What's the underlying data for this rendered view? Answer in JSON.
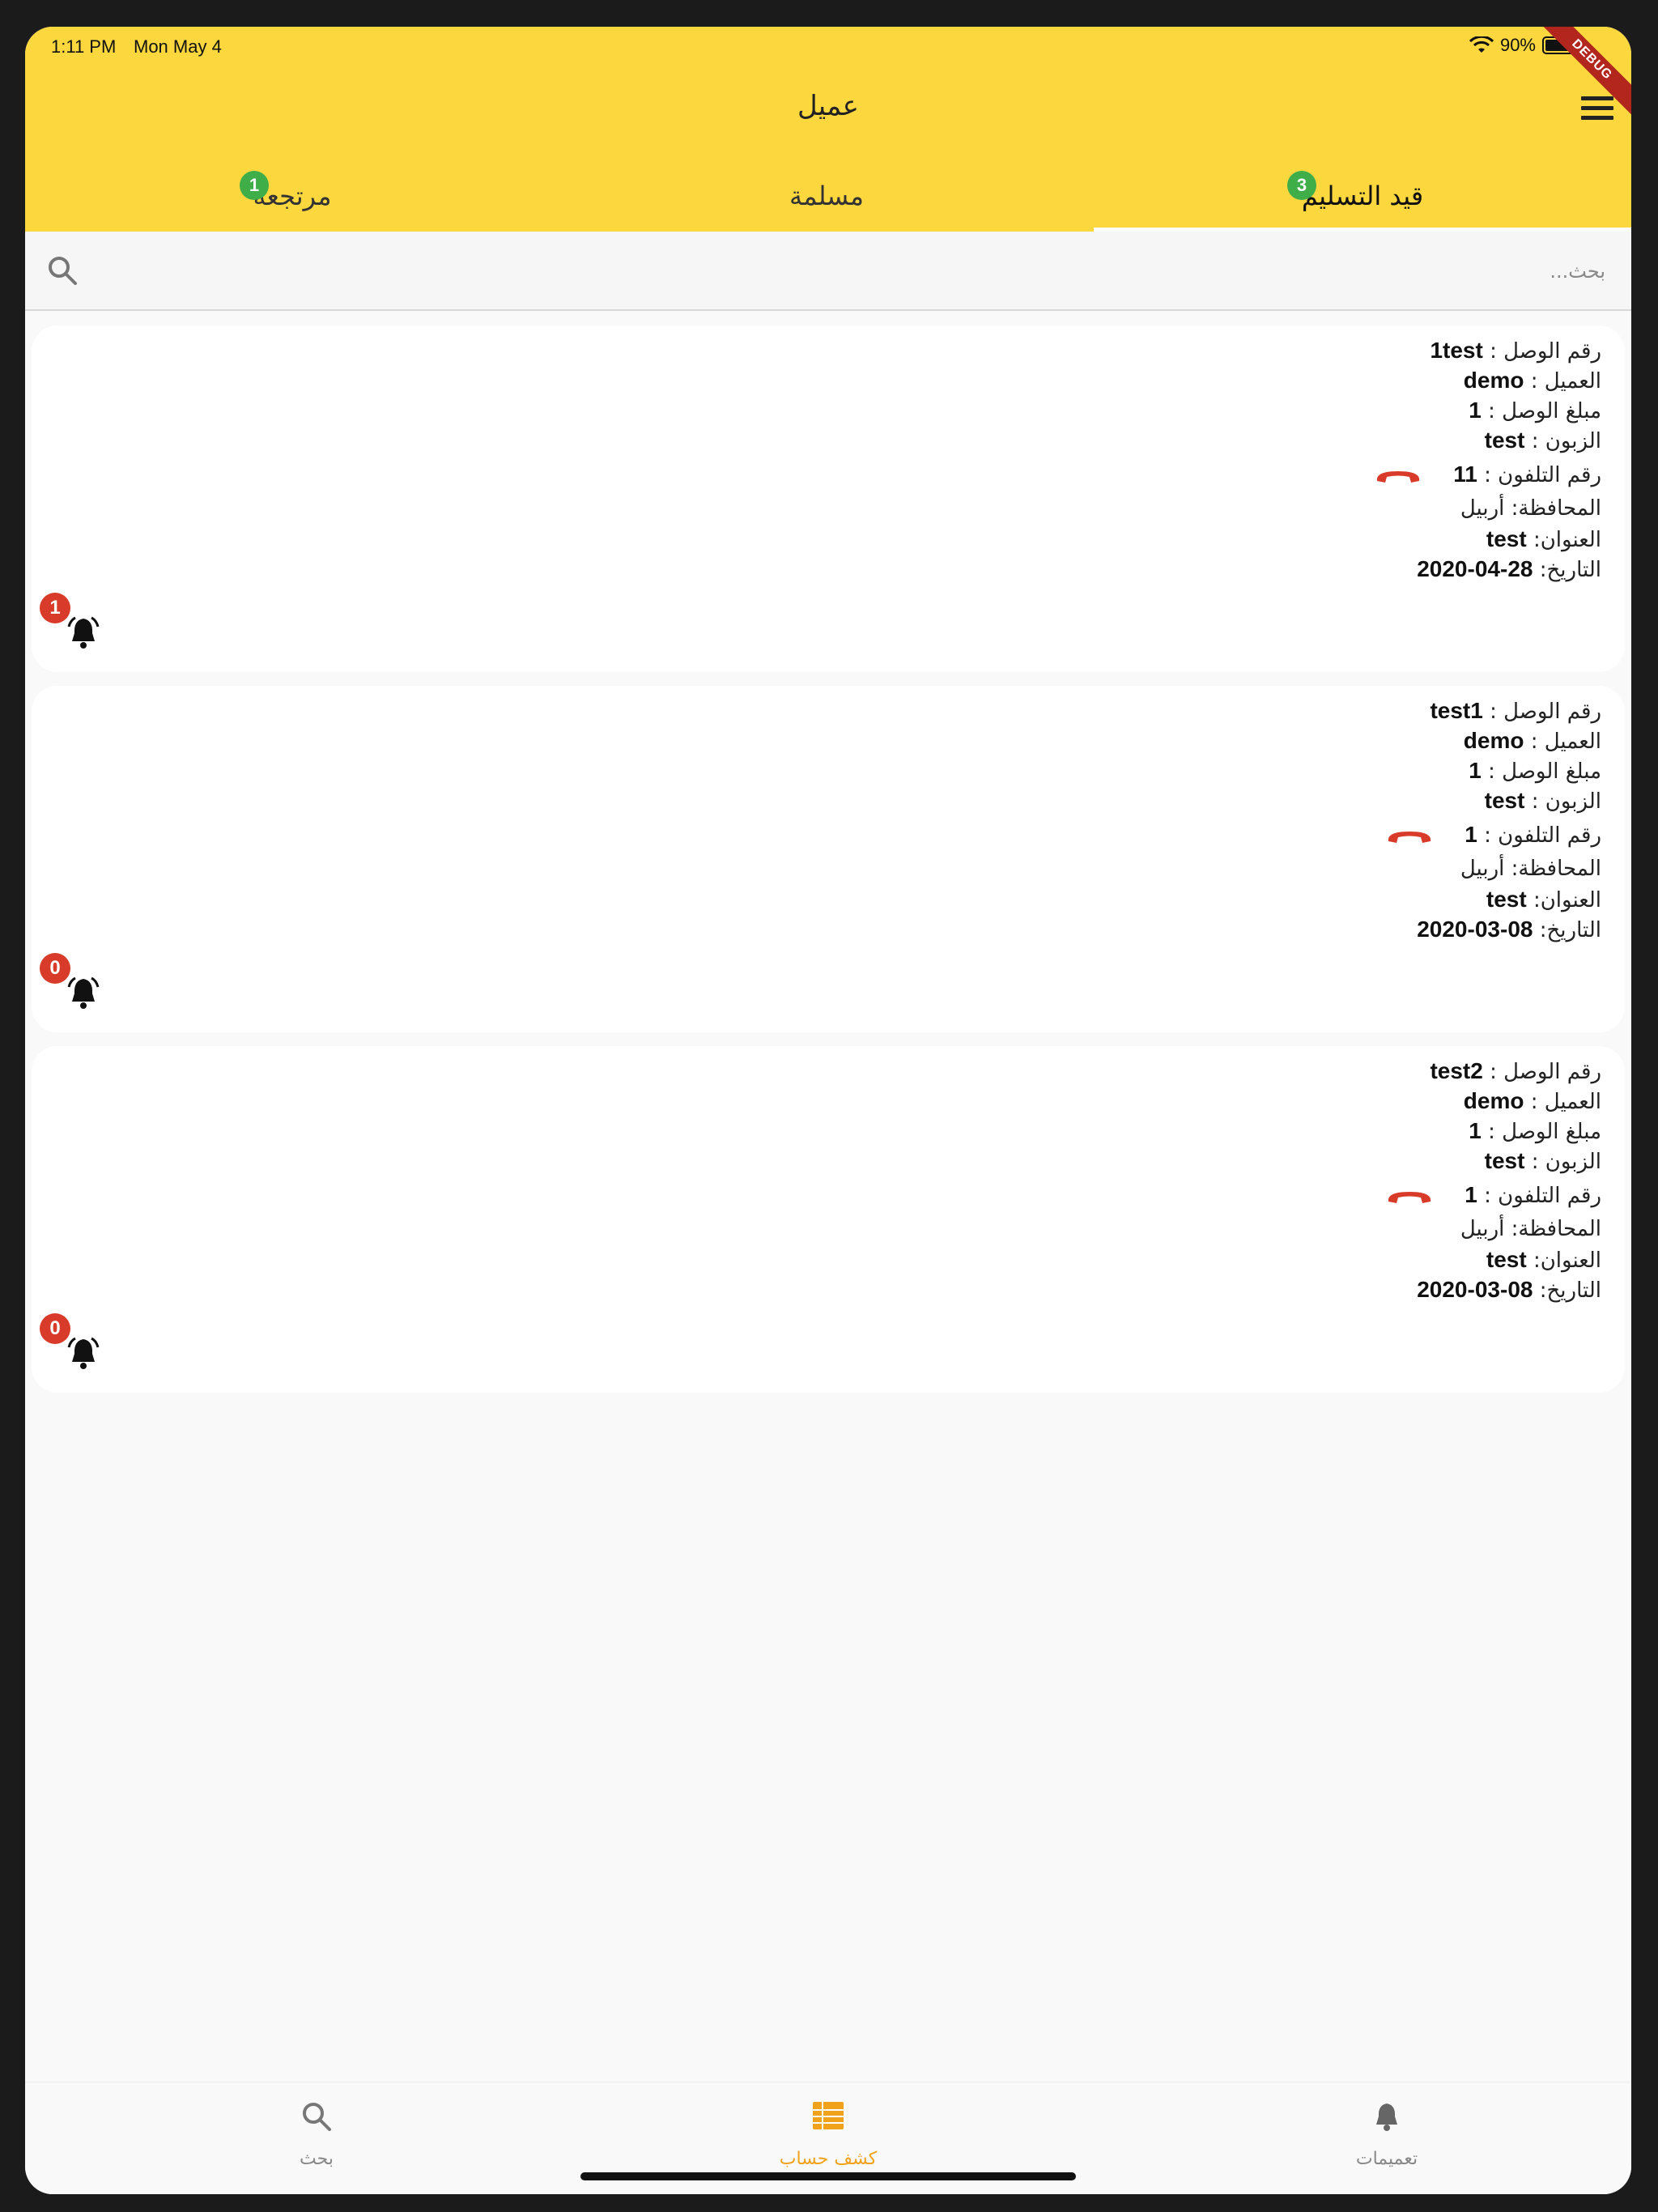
{
  "status_bar": {
    "time": "1:11 PM",
    "date": "Mon May 4",
    "battery": "90%",
    "battery_level": 0.9
  },
  "debug_banner": "DEBUG",
  "app_bar": {
    "title": "عميل"
  },
  "tabs": [
    {
      "label": "قيد التسليم",
      "badge": "3",
      "active": true
    },
    {
      "label": "مسلمة",
      "badge": null,
      "active": false
    },
    {
      "label": "مرتجعة",
      "badge": "1",
      "active": false
    }
  ],
  "search": {
    "placeholder": "بحث..."
  },
  "labels": {
    "receipt": "رقم الوصل :",
    "client": "العميل :",
    "amount": "مبلغ الوصل :",
    "customer": "الزبون :",
    "phone": "رقم التلفون :",
    "governorate": "المحافظة:",
    "address": "العنوان:",
    "date": "التاريخ:"
  },
  "orders": [
    {
      "receipt": "1test",
      "client": "demo",
      "amount": "1",
      "customer": "test",
      "phone": "11",
      "governorate": "أربيل",
      "address": "test",
      "date": "28-04-2020",
      "notifications": "1"
    },
    {
      "receipt": "test1",
      "client": "demo",
      "amount": "1",
      "customer": "test",
      "phone": "1",
      "governorate": "أربيل",
      "address": "test",
      "date": "08-03-2020",
      "notifications": "0"
    },
    {
      "receipt": "test2",
      "client": "demo",
      "amount": "1",
      "customer": "test",
      "phone": "1",
      "governorate": "أربيل",
      "address": "test",
      "date": "08-03-2020",
      "notifications": "0"
    }
  ],
  "bottom_nav": [
    {
      "label": "بحث",
      "icon": "search-icon",
      "active": false
    },
    {
      "label": "كشف حساب",
      "icon": "ledger-icon",
      "active": true
    },
    {
      "label": "تعميمات",
      "icon": "bell-icon",
      "active": false
    }
  ],
  "colors": {
    "appbar": "#fcd73e",
    "tab_badge": "#3fae49",
    "alert_badge": "#d93b2b",
    "phone": "#d93b2b",
    "nav_active": "#f0a21a"
  }
}
